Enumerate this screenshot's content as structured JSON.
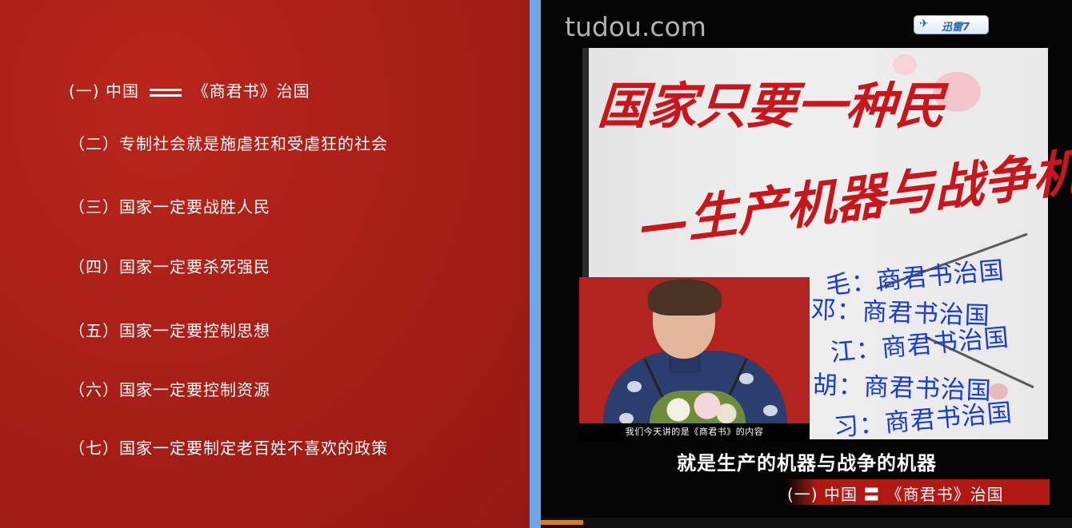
{
  "slide": {
    "item1": {
      "prefix": "(一) 中国",
      "suffix": "《商君书》治国"
    },
    "items": [
      "（二）专制社会就是施虐狂和受虐狂的社会",
      "（三）国家一定要战胜人民",
      "（四）国家一定要杀死强民",
      "（五）国家一定要控制思想",
      "（六）国家一定要控制资源",
      "（七）国家一定要制定老百姓不喜欢的政策"
    ]
  },
  "player": {
    "watermark": "tudou.com",
    "badge_label": "迅雷7",
    "backdrop_title_line1": "国家只要一种民",
    "backdrop_title_line2": "—生产机器与战争机器",
    "inset_caption": "我们今天讲的是《商君书》的内容",
    "overlay_lines": [
      "毛：商君书治国",
      "邓：商君书治国",
      "江：商君书治国",
      "胡：商君书治国",
      "习：商君书治国"
    ],
    "subtitle": "就是生产的机器与战争的机器",
    "lower_third": "(一) 中国 〓 《商君书》治国",
    "progress_fraction": 0.08
  },
  "colors": {
    "slide_red": "#a51e16",
    "overlay_blue": "#1a3bd6",
    "title_red": "#c8161d",
    "progress_orange": "#e07b10"
  }
}
